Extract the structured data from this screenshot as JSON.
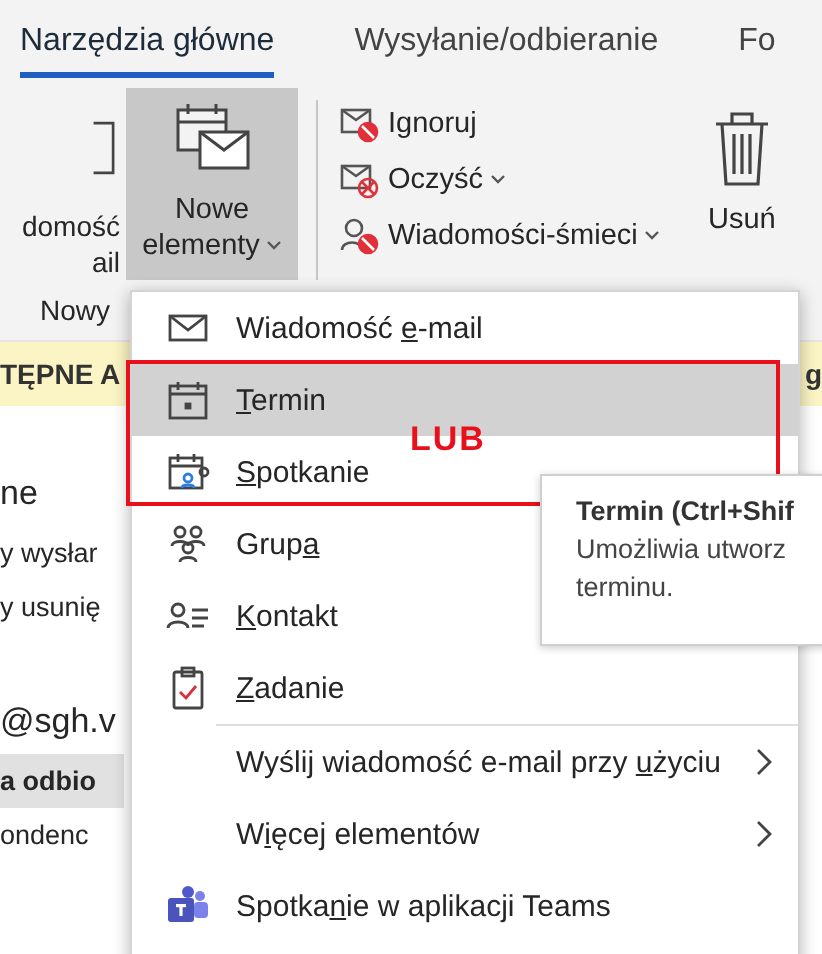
{
  "tabs": [
    {
      "label": "Narzędzia główne",
      "selected": true
    },
    {
      "label": "Wysyłanie/odbieranie",
      "selected": false
    },
    {
      "label": "Fo",
      "selected": false
    }
  ],
  "ribbon": {
    "new_email_partial": [
      "domość",
      "ail"
    ],
    "new_items": {
      "lines": [
        "Nowe",
        "elementy"
      ],
      "pressed": true,
      "dropdown": true
    },
    "actions": [
      {
        "label": "Ignoruj",
        "kind": "ignore",
        "dropdown": false
      },
      {
        "label": "Oczyść",
        "kind": "clean",
        "dropdown": true
      },
      {
        "label": "Wiadomości-śmieci",
        "kind": "junk",
        "dropdown": true
      }
    ],
    "delete": "Usuń",
    "group_label": "Nowy"
  },
  "info_bar": {
    "text": "TĘPNE A",
    "tail": "g"
  },
  "left_pane": [
    {
      "text": "ne",
      "kind": "folder"
    },
    {
      "text": "y wysłar",
      "kind": "item"
    },
    {
      "text": "y usunię",
      "kind": "item"
    },
    {
      "text": "@sgh.v",
      "kind": "account"
    },
    {
      "text": "a odbio",
      "kind": "current"
    },
    {
      "text": "ondenc",
      "kind": "item"
    }
  ],
  "menu": [
    {
      "before": "Wiadomość ",
      "key": "e",
      "after": "-mail",
      "kind": "item",
      "selected": false
    },
    {
      "key": "T",
      "after": "ermin",
      "kind": "item",
      "selected": true
    },
    {
      "key": "S",
      "after": "potkanie",
      "kind": "item",
      "selected": false
    },
    {
      "before": "Grup",
      "key": "a",
      "kind": "item",
      "selected": false
    },
    {
      "key": "K",
      "after": "ontakt",
      "kind": "item",
      "selected": false
    },
    {
      "key": "Z",
      "after": "adanie",
      "kind": "item",
      "selected": false
    },
    {
      "kind": "separator"
    },
    {
      "before": "Wyślij wiadomość e-mail przy ",
      "key": "u",
      "after": "życiu",
      "kind": "submenu",
      "selected": false
    },
    {
      "before": "W",
      "key": "i",
      "after": "ęcej elementów",
      "kind": "submenu",
      "selected": false
    },
    {
      "before": "Spotka",
      "key": "n",
      "after": "ie w aplikacji Teams",
      "kind": "item",
      "selected": false
    }
  ],
  "annotation": {
    "label": "LUB"
  },
  "tooltip": {
    "title": "Termin (Ctrl+Shif",
    "lines": [
      "Umożliwia utworz",
      "terminu."
    ]
  }
}
